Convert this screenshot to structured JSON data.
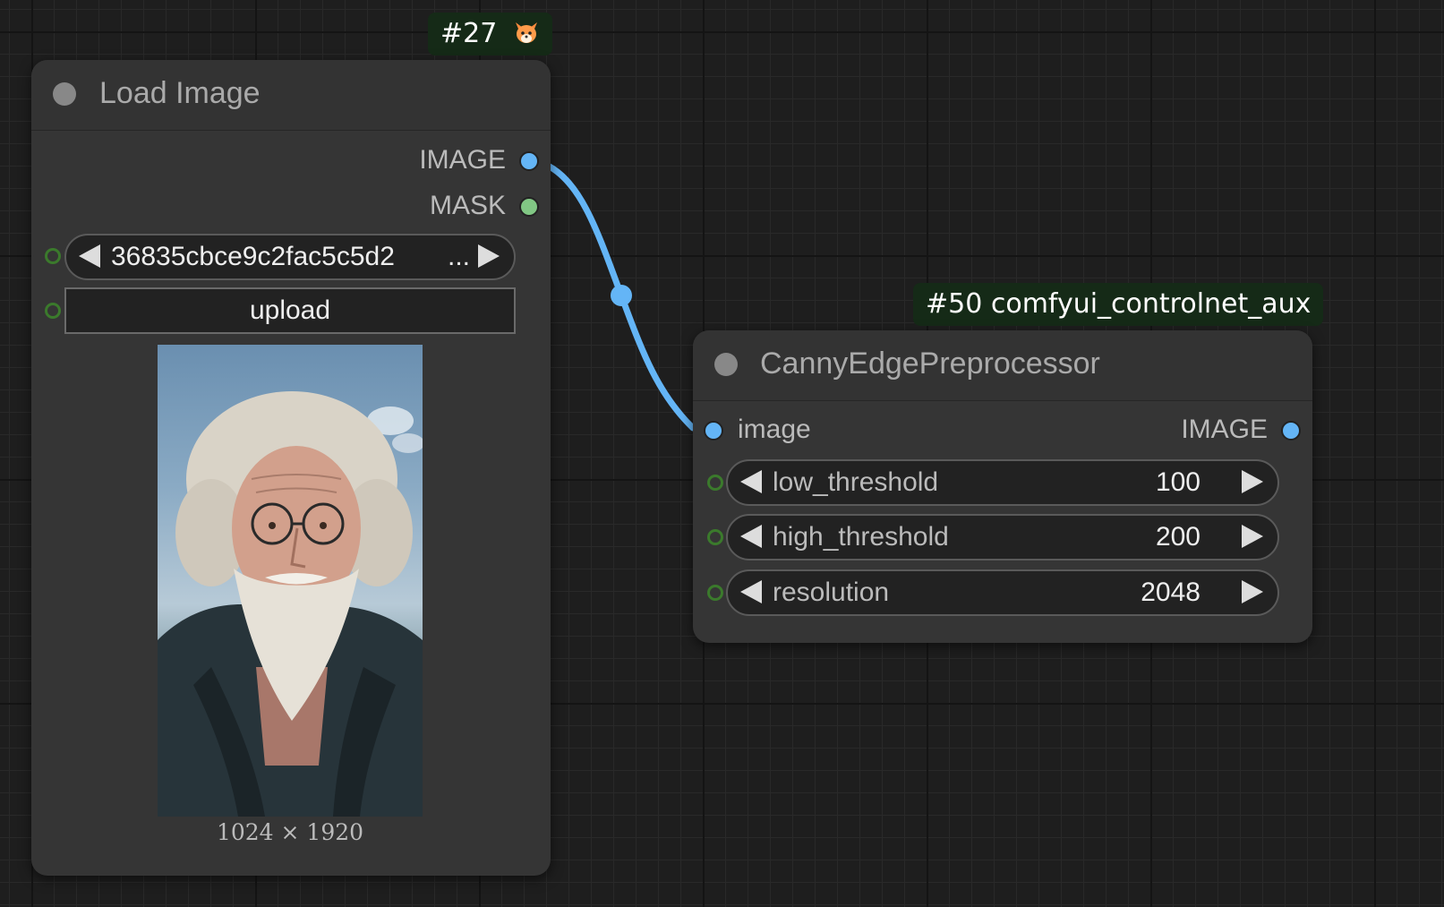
{
  "load_image_node": {
    "badge": "#27",
    "badge_icon": "fox-icon",
    "title": "Load Image",
    "outputs": [
      {
        "label": "IMAGE",
        "color": "#64b5f6"
      },
      {
        "label": "MASK",
        "color": "#81c784"
      }
    ],
    "image_widget": {
      "value": "36835cbce9c2fac5c5d2",
      "ellipsis": "..."
    },
    "upload_label": "upload",
    "preview_dims": "1024 × 1920"
  },
  "canny_node": {
    "badge": "#50 comfyui_controlnet_aux",
    "title": "CannyEdgePreprocessor",
    "input_label": "image",
    "output_label": "IMAGE",
    "widgets": [
      {
        "name": "low_threshold",
        "value": "100"
      },
      {
        "name": "high_threshold",
        "value": "200"
      },
      {
        "name": "resolution",
        "value": "2048"
      }
    ]
  },
  "colors": {
    "image_link": "#64b5f6",
    "mask": "#81c784",
    "badge_bg": "#152a17",
    "node_bg": "#353535"
  }
}
